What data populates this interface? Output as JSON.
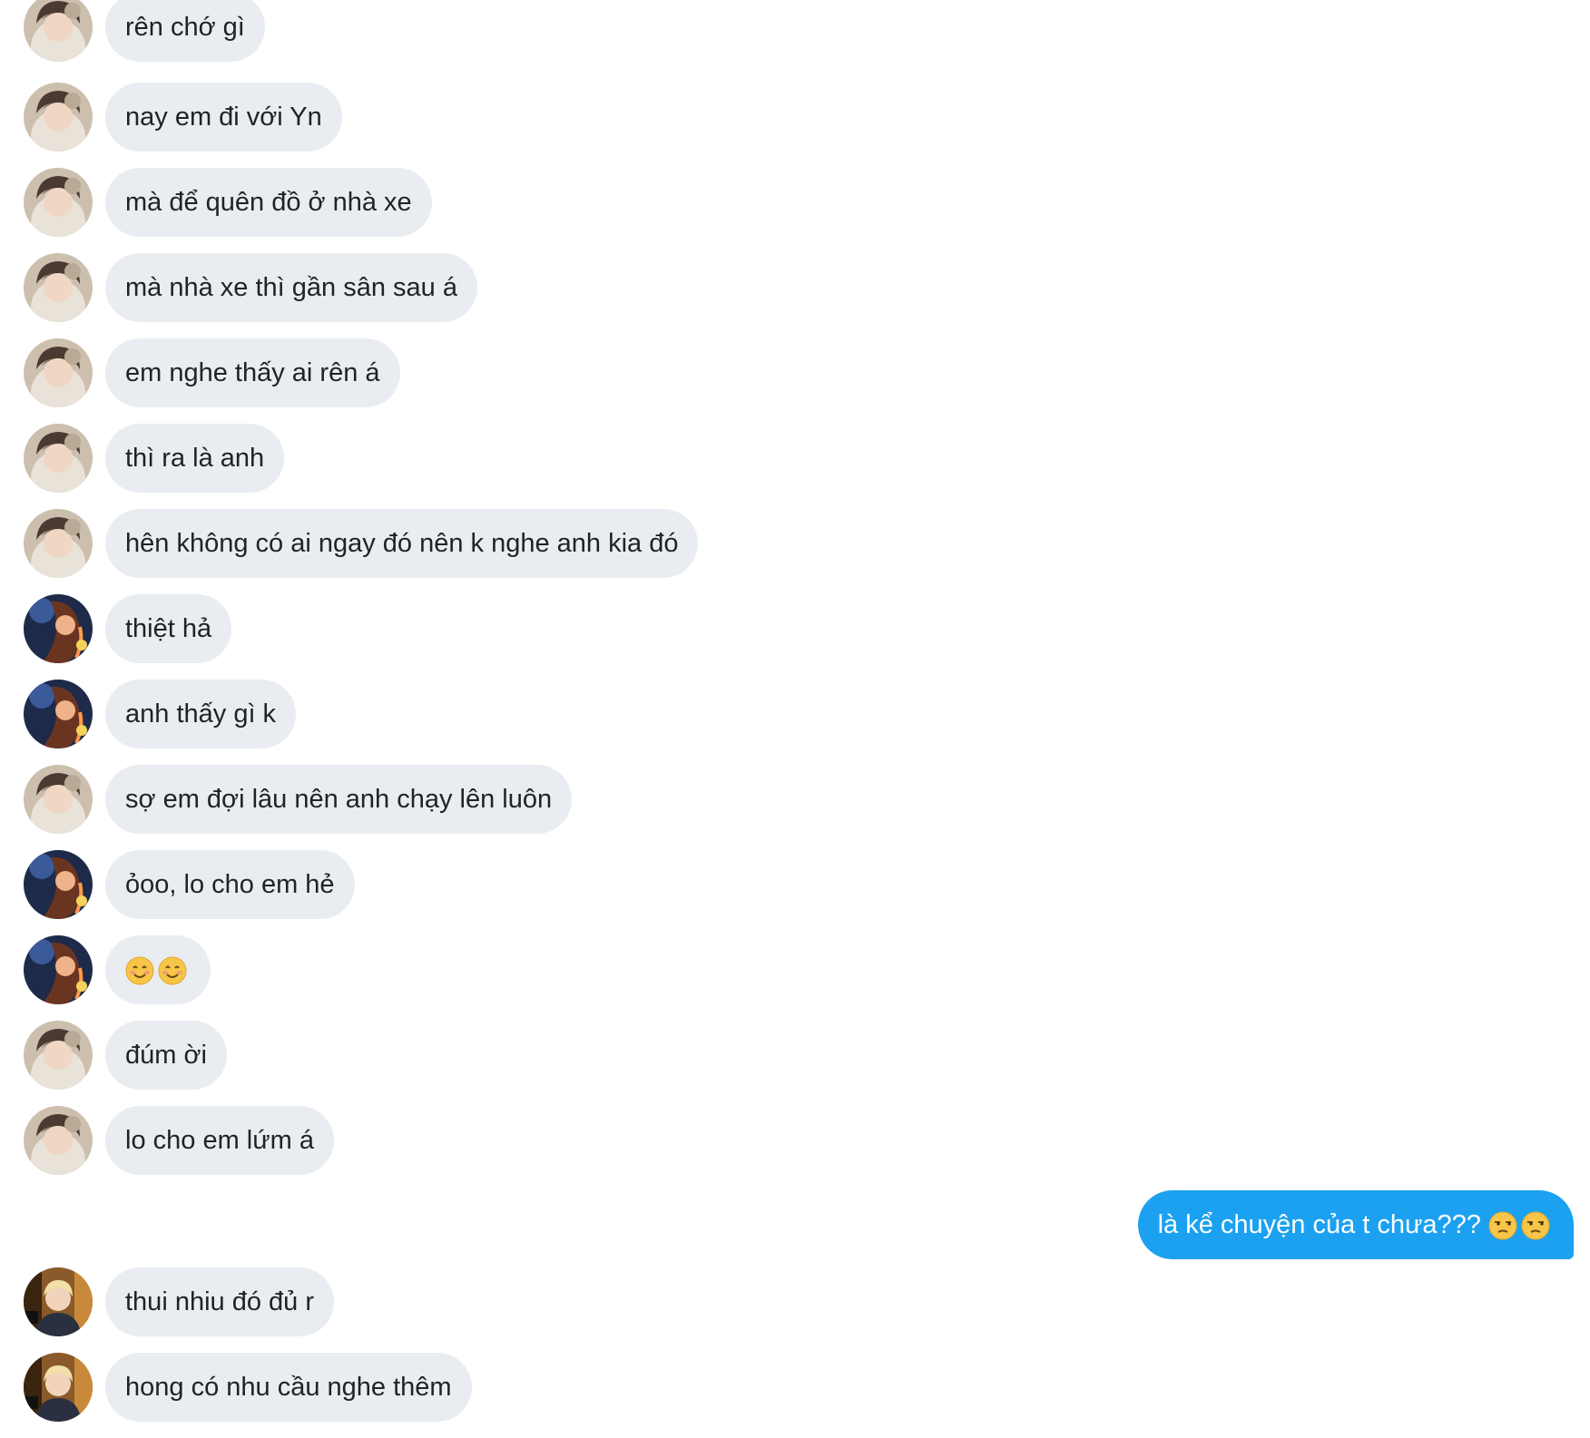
{
  "conversation": {
    "messages": [
      {
        "sender": "boy",
        "text": "rên chớ gì"
      },
      {
        "sender": "boy",
        "text": "nay em đi với Yn"
      },
      {
        "sender": "boy",
        "text": "mà để quên đồ ở nhà xe"
      },
      {
        "sender": "boy",
        "text": "mà nhà xe thì gần sân sau á"
      },
      {
        "sender": "boy",
        "text": "em nghe thấy ai rên á"
      },
      {
        "sender": "boy",
        "text": "thì ra là anh"
      },
      {
        "sender": "boy",
        "text": "hên không có ai ngay đó nên k nghe anh kia đó"
      },
      {
        "sender": "girl",
        "text": "thiệt hả"
      },
      {
        "sender": "girl",
        "text": "anh thấy gì k"
      },
      {
        "sender": "boy",
        "text": "sợ em đợi lâu nên anh chạy lên luôn"
      },
      {
        "sender": "girl",
        "text": "ỏoo, lo cho em hẻ"
      },
      {
        "sender": "girl",
        "text": "",
        "emojis": [
          "smiling-face",
          "smiling-face"
        ]
      },
      {
        "sender": "boy",
        "text": "đúm ời"
      },
      {
        "sender": "boy",
        "text": "lo cho em lứm á"
      },
      {
        "sender": "self",
        "text": "là kể chuyện của t chưa??? ",
        "emojis": [
          "unamused-face",
          "unamused-face"
        ]
      },
      {
        "sender": "blond",
        "text": "thui nhiu đó đủ r"
      },
      {
        "sender": "blond",
        "text": "hong có nhu cầu nghe thêm"
      }
    ]
  },
  "colors": {
    "incoming_bubble": "#e9edf1",
    "outgoing_bubble": "#1ca1f1",
    "incoming_text": "#1f2327",
    "outgoing_text": "#ffffff"
  }
}
